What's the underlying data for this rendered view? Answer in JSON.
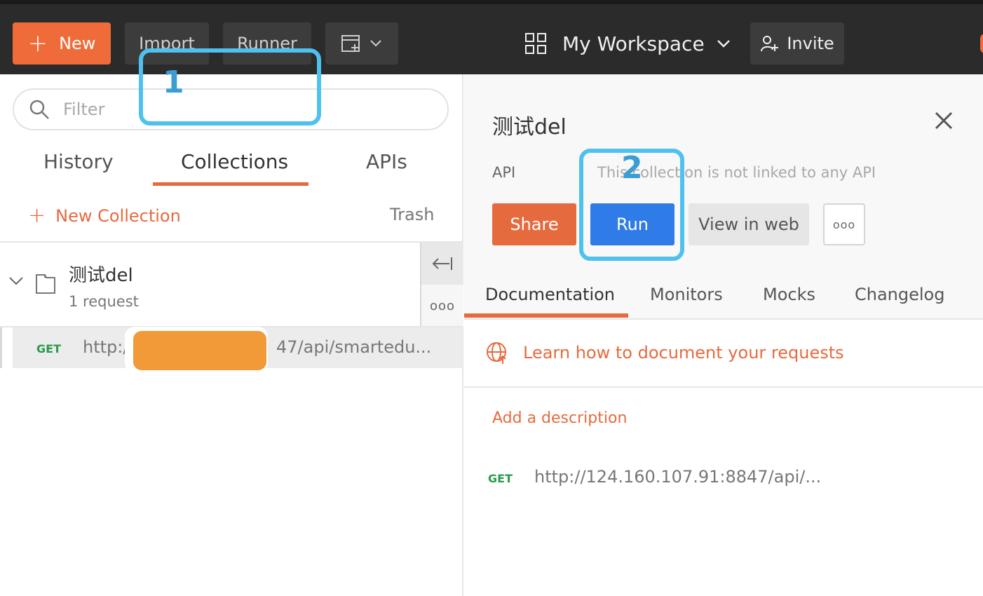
{
  "topbar": {
    "new_label": "New",
    "import_label": "Import",
    "runner_label": "Runner",
    "workspace_label": "My Workspace",
    "invite_label": "Invite"
  },
  "sidebar": {
    "filter_placeholder": "Filter",
    "tabs": [
      "History",
      "Collections",
      "APIs"
    ],
    "active_tab": "Collections",
    "new_collection_label": "New Collection",
    "trash_label": "Trash",
    "collection": {
      "name": "测试del",
      "subtitle": "1 request"
    },
    "request": {
      "method": "GET",
      "url_prefix": "http:/",
      "url_suffix": "47/api/smartedu..."
    }
  },
  "annotations": [
    "1",
    "2"
  ],
  "panel": {
    "title": "测试del",
    "api_label": "API",
    "api_text": "This collection is not linked to any API",
    "share_label": "Share",
    "run_label": "Run",
    "view_web_label": "View in web",
    "tabs": [
      "Documentation",
      "Monitors",
      "Mocks",
      "Changelog"
    ],
    "active_tab": "Documentation",
    "learn_label": "Learn how to document your requests",
    "add_description_label": "Add a description",
    "request": {
      "method": "GET",
      "url": "http://124.160.107.91:8847/api/..."
    }
  },
  "colors": {
    "accent": "#e56b3f",
    "run_blue": "#2f7be8",
    "annotation": "#4fc1ef",
    "get_green": "#2a9a4a"
  }
}
